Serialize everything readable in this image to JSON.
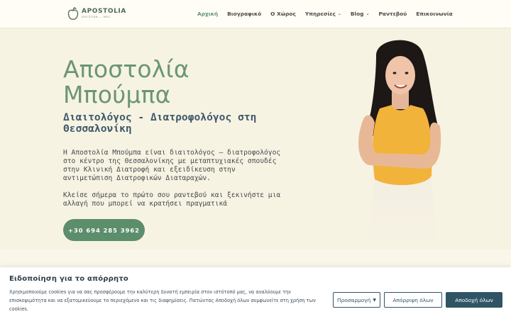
{
  "header": {
    "logo": {
      "name": "APOSTOLIA",
      "tagline": "DIETITIAN — MSC"
    },
    "nav": [
      {
        "label": "Αρχική",
        "active": true,
        "dropdown": false
      },
      {
        "label": "Βιογραφικό",
        "active": false,
        "dropdown": false
      },
      {
        "label": "Ο Χώρος",
        "active": false,
        "dropdown": false
      },
      {
        "label": "Υπηρεσίες",
        "active": false,
        "dropdown": true
      },
      {
        "label": "Blog",
        "active": false,
        "dropdown": true
      },
      {
        "label": "Ραντεβού",
        "active": false,
        "dropdown": false
      },
      {
        "label": "Επικοινωνία",
        "active": false,
        "dropdown": false
      }
    ]
  },
  "hero": {
    "title_line1": "Αποστολία",
    "title_line2": "Μπούμπα",
    "subtitle_line1": "Διαιτολόγος - Διατροφολόγος στη",
    "subtitle_line2": "Θεσσαλονίκη",
    "paragraph1": "Η Αποστολία Μπούμπα είναι διαιτολόγος – διατροφολόγος στο κέντρο της Θεσσαλονίκης με μεταπτυχιακές σπουδές στην Κλινική Διατροφή και εξειδίκευση στην αντιμετώπιση Διατροφικών Διαταραχών.",
    "paragraph2": "Κλείσε σήμερα το πρώτο σου ραντεβού και ξεκινήστε μια αλλαγή που μπορεί να κρατήσει πραγματικά",
    "phone_button": "+30 694 285 3962"
  },
  "cookie_banner": {
    "title": "Ειδοποίηση για το απόρρητο",
    "text": "Χρησιμοποιούμε cookies για να σας προσφέρουμε την καλύτερη δυνατή εμπειρία στον ιστότοπό μας, να αναλύουμε την επισκεψιμότητα και να εξατομικεύουμε το περιεχόμενο και τις διαφημίσεις. Πατώντας Αποδοχή όλων συμφωνείτε στη χρήση των cookies.",
    "customize_label": "Προσαρμογή",
    "reject_label": "Απόρριψη όλων",
    "accept_label": "Αποδοχή όλων"
  },
  "colors": {
    "accent_green": "#5c8e6b",
    "title_green": "#6a9676",
    "background": "#f7f3e3",
    "cookie_primary": "#2f5565"
  },
  "icons": {
    "logo": "apple-leaf-icon",
    "dropdown": "chevron-down-icon",
    "customize_caret": "caret-down-icon"
  }
}
